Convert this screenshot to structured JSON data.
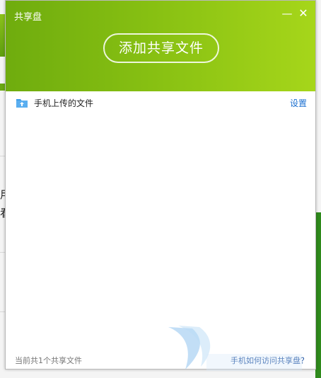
{
  "dialog": {
    "title": "共享盘",
    "minimize_symbol": "—",
    "close_symbol": "✕",
    "add_button_label": "添加共享文件"
  },
  "folder": {
    "name": "手机上传的文件",
    "icon": "folder-upload-icon",
    "settings_label": "设置"
  },
  "footer": {
    "count_text": "当前共1个共享文件",
    "help_link": "手机如何访问共享盘？"
  },
  "background": {
    "chars": [
      "用",
      "看"
    ]
  },
  "colors": {
    "header_start": "#6fac0e",
    "header_end": "#a6d61a",
    "link": "#1a6fd0"
  }
}
